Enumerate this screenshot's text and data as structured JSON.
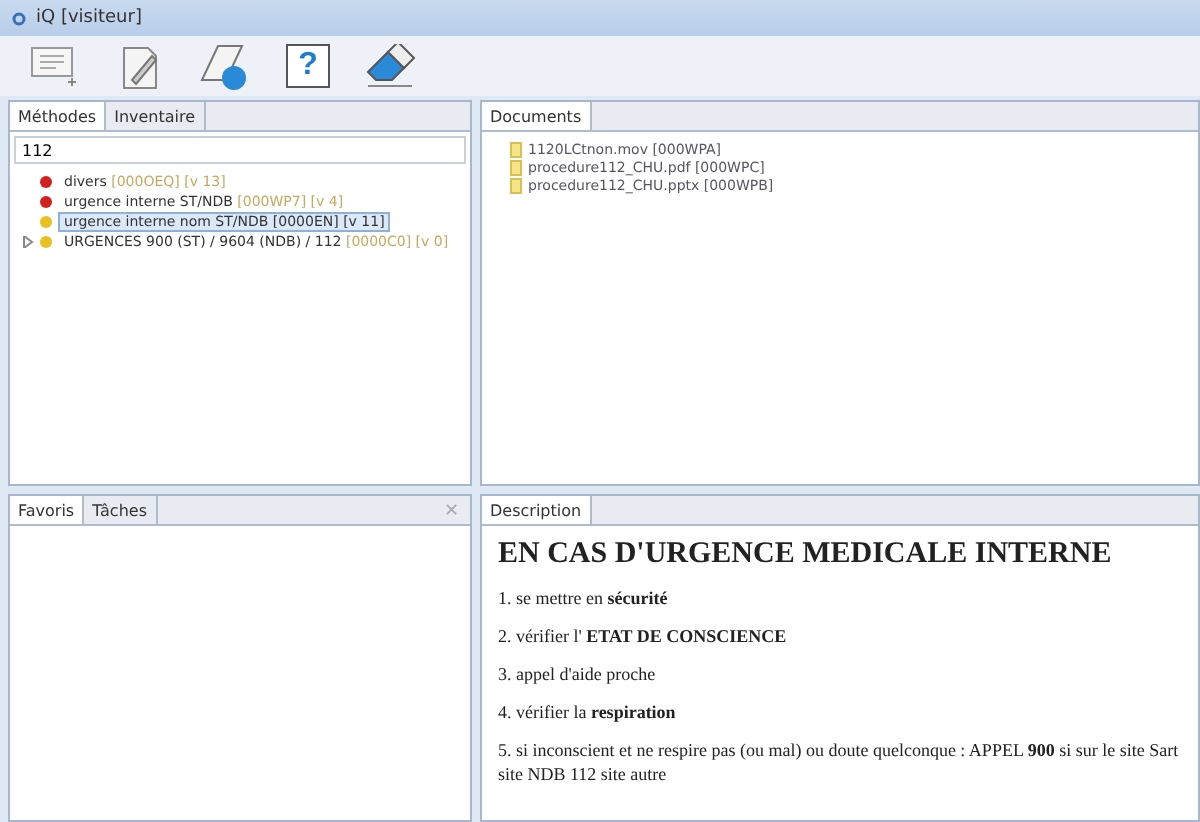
{
  "window": {
    "title": "iQ [visiteur]"
  },
  "toolbar": [
    {
      "kind": "note"
    },
    {
      "kind": "edit"
    },
    {
      "kind": "web"
    },
    {
      "kind": "help",
      "label": "?"
    },
    {
      "kind": "eraser"
    }
  ],
  "left_panel": {
    "tabs": [
      {
        "label": "Méthodes",
        "selected": true
      },
      {
        "label": "Inventaire",
        "selected": false
      }
    ],
    "search": {
      "value": "112"
    },
    "tree": [
      {
        "label": "divers",
        "code": "[000OEQ] [v 13]",
        "color": "#d02020",
        "selected": false
      },
      {
        "label": "urgence interne ST/NDB",
        "code": "[000WP7] [v 4]",
        "color": "#d02020",
        "selected": false
      },
      {
        "label": "urgence interne nom ST/NDB [0000EN] [v 11]",
        "color": "#e8c020",
        "selected": true
      },
      {
        "label": "URGENCES 900 (ST) / 9604 (NDB) / 112",
        "code": "[0000C0] [v 0]",
        "color": "#e8c020",
        "selected": false,
        "expanded": false
      }
    ]
  },
  "documents_panel": {
    "tab": "Documents",
    "files": [
      "1120LCtnon.mov [000WPA]",
      "procedure112_CHU.pdf [000WPC]",
      "procedure112_CHU.pptx [000WPB]"
    ]
  },
  "favorites_panel": {
    "tabs": [
      {
        "label": "Favoris",
        "selected": true
      },
      {
        "label": "Tâches",
        "selected": false
      }
    ],
    "close": "✕"
  },
  "description_panel": {
    "tab": "Description",
    "heading": "EN CAS D'URGENCE MEDICALE INTERNE",
    "lines": [
      "1. se mettre en **sécurité**",
      "2. vérifier l' **ETAT DE CONSCIENCE**",
      "3. appel d'aide proche",
      "4. vérifier la **respiration**",
      "5. si inconscient et ne respire pas (ou mal) ou doute quelconque : APPEL **900** si sur le site Sart",
      "site NDB        112 site autre"
    ]
  }
}
